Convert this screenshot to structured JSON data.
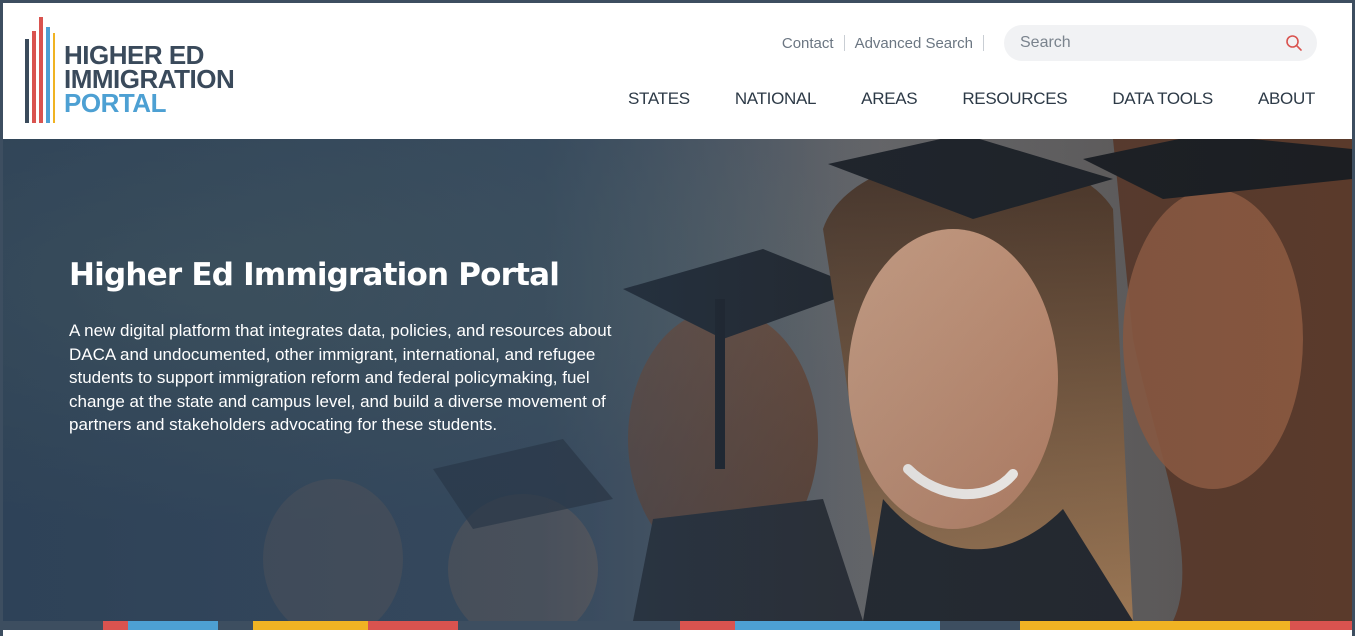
{
  "header": {
    "logo": {
      "lines": [
        "HIGHER ED",
        "IMMIGRATION",
        "PORTAL"
      ],
      "bar_colors": [
        "#d9534f",
        "#4da0d3",
        "#f0b323",
        "#3a4a5b"
      ]
    },
    "top_links": {
      "contact": "Contact",
      "advanced_search": "Advanced Search"
    },
    "search": {
      "placeholder": "Search",
      "icon": "search-icon",
      "icon_color": "#d9534f"
    },
    "nav": [
      "STATES",
      "NATIONAL",
      "AREAS",
      "RESOURCES",
      "DATA TOOLS",
      "ABOUT"
    ]
  },
  "hero": {
    "title": "Higher Ed Immigration Portal",
    "description": "A new digital platform that integrates data, policies, and resources about DACA and undocumented, other immigrant, international, and refugee students to support immigration reform and federal policymaking, fuel change at the state and campus level, and build a diverse movement of partners and stakeholders advocating for these students."
  },
  "colors": {
    "brand_dark": "#3a4a5b",
    "brand_blue": "#4da0d3",
    "brand_red": "#d9534f",
    "brand_yellow": "#f0b323",
    "frame_border": "#3d4e60"
  }
}
